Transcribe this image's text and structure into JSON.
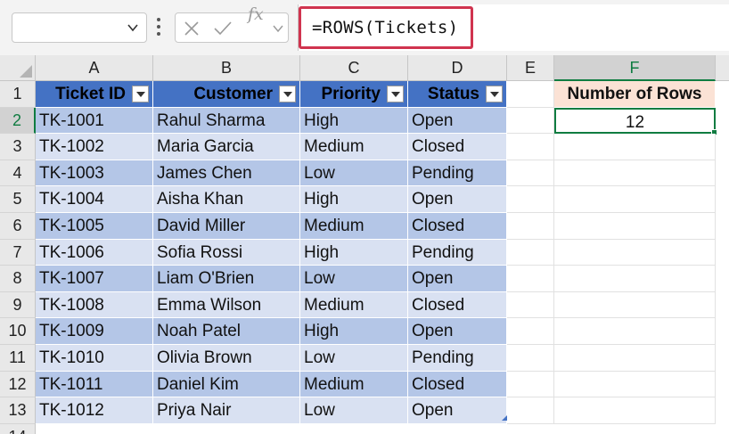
{
  "formula_bar": {
    "name_box": "",
    "fx_label": "fx",
    "formula": "=ROWS(Tickets)"
  },
  "columns": [
    "A",
    "B",
    "C",
    "D",
    "E",
    "F"
  ],
  "rows": [
    "1",
    "2",
    "3",
    "4",
    "5",
    "6",
    "7",
    "8",
    "9",
    "10",
    "11",
    "12",
    "13",
    "14"
  ],
  "table": {
    "name": "Tickets",
    "headers": [
      "Ticket ID",
      "Customer",
      "Priority",
      "Status"
    ],
    "data": [
      [
        "TK-1001",
        "Rahul Sharma",
        "High",
        "Open"
      ],
      [
        "TK-1002",
        "Maria Garcia",
        "Medium",
        "Closed"
      ],
      [
        "TK-1003",
        "James Chen",
        "Low",
        "Pending"
      ],
      [
        "TK-1004",
        "Aisha Khan",
        "High",
        "Open"
      ],
      [
        "TK-1005",
        "David Miller",
        "Medium",
        "Closed"
      ],
      [
        "TK-1006",
        "Sofia Rossi",
        "High",
        "Pending"
      ],
      [
        "TK-1007",
        "Liam O'Brien",
        "Low",
        "Open"
      ],
      [
        "TK-1008",
        "Emma Wilson",
        "Medium",
        "Closed"
      ],
      [
        "TK-1009",
        "Noah Patel",
        "High",
        "Open"
      ],
      [
        "TK-1010",
        "Olivia Brown",
        "Low",
        "Pending"
      ],
      [
        "TK-1011",
        "Daniel Kim",
        "Medium",
        "Closed"
      ],
      [
        "TK-1012",
        "Priya Nair",
        "Low",
        "Open"
      ]
    ]
  },
  "result": {
    "label": "Number of Rows",
    "value": "12"
  },
  "colors": {
    "header_blue": "#4472c4",
    "band_dark": "#b4c6e7",
    "band_light": "#d9e1f2",
    "selection_green": "#107c41",
    "formula_highlight": "#d0344f",
    "label_fill": "#fbe2d5"
  }
}
